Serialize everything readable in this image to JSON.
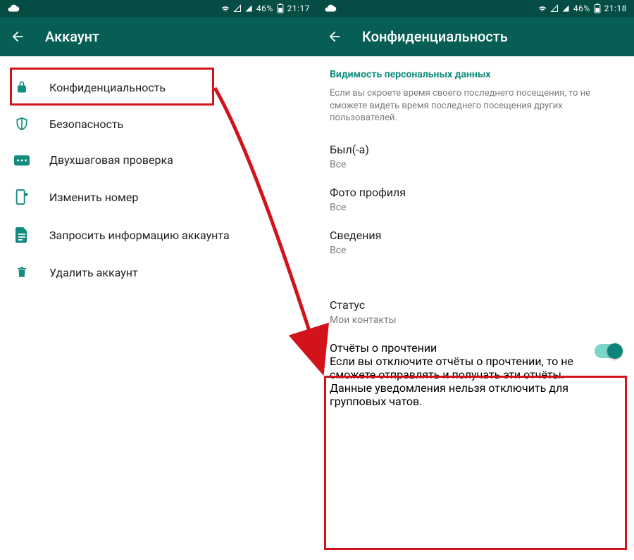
{
  "left": {
    "status": {
      "battery": "46%",
      "time": "21:17"
    },
    "title": "Аккаунт",
    "items": [
      {
        "label": "Конфиденциальность"
      },
      {
        "label": "Безопасность"
      },
      {
        "label": "Двухшаговая проверка"
      },
      {
        "label": "Изменить номер"
      },
      {
        "label": "Запросить информацию аккаунта"
      },
      {
        "label": "Удалить аккаунт"
      }
    ]
  },
  "right": {
    "status": {
      "battery": "46%",
      "time": "21:18"
    },
    "title": "Конфиденциальность",
    "section_header": "Видимость персональных данных",
    "section_desc": "Если вы скроете время своего последнего посещения, то не сможете видеть время последнего посещения других пользователей.",
    "prefs": {
      "last_seen": {
        "title": "Был(-а)",
        "value": "Все"
      },
      "photo": {
        "title": "Фото профиля",
        "value": "Все"
      },
      "about": {
        "title": "Сведения",
        "value": "Все"
      },
      "status": {
        "title": "Статус",
        "value": "Мои контакты"
      },
      "receipts": {
        "title": "Отчёты о прочтении",
        "desc": "Если вы отключите отчёты о прочтении, то не сможете отправлять и получать эти отчёты. Данные уведомления нельзя отключить для групповых чатов."
      }
    }
  },
  "colors": {
    "brand": "#075e54",
    "accent": "#128c7e",
    "toggle": "#0b8577"
  }
}
